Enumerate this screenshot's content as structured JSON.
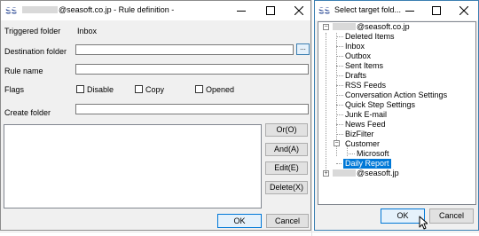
{
  "rule_window": {
    "title_suffix": "@seasoft.co.jp - Rule definition -",
    "fields": {
      "triggered_folder_label": "Triggered folder",
      "triggered_folder_value": "Inbox",
      "destination_folder_label": "Destination folder",
      "destination_folder_value": "",
      "browse_label": "...",
      "rule_name_label": "Rule name",
      "rule_name_value": "",
      "flags_label": "Flags",
      "create_folder_label": "Create folder",
      "create_folder_value": ""
    },
    "flags": [
      {
        "label": "Disable",
        "checked": false
      },
      {
        "label": "Copy",
        "checked": false
      },
      {
        "label": "Opened",
        "checked": false
      }
    ],
    "side_buttons": [
      "Or(O)",
      "And(A)",
      "Edit(E)",
      "Delete(X)"
    ],
    "ok_label": "OK",
    "cancel_label": "Cancel"
  },
  "folder_window": {
    "title": "Select target fold...",
    "account_root_suffix": "@seasoft.co.jp",
    "folders": [
      "Deleted Items",
      "Inbox",
      "Outbox",
      "Sent Items",
      "Drafts",
      "RSS Feeds",
      "Conversation Action Settings",
      "Quick Step Settings",
      "Junk E-mail",
      "News Feed",
      "BizFilter",
      "Customer",
      "Microsoft",
      "Daily Report"
    ],
    "second_account_suffix": "@seasoft.jp",
    "selected_folder": "Daily Report",
    "ok_label": "OK",
    "cancel_label": "Cancel"
  },
  "colors": {
    "accent": "#0078d7",
    "logo": "#1f3f8f",
    "window_bg": "#f0f0f0"
  }
}
